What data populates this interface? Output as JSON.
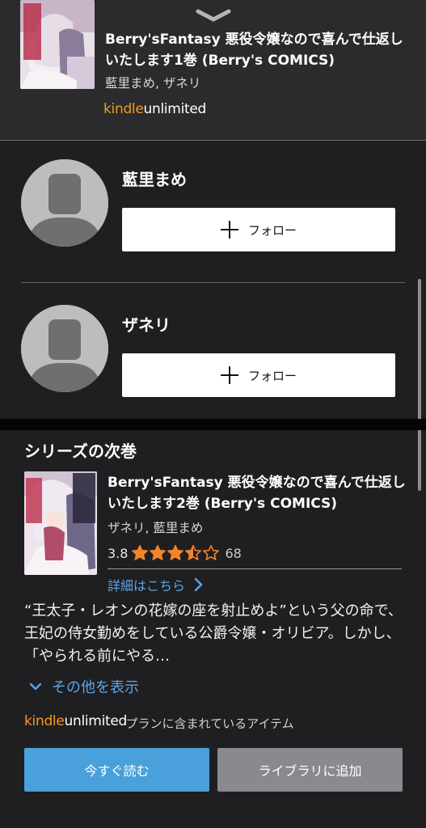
{
  "current_book": {
    "title": "Berry'sFantasy 悪役令嬢なので喜んで仕返しいたします1巻 (Berry's COMICS)",
    "authors": "藍里まめ, ザネリ",
    "kindle_unlimited": {
      "kindle": "kindle",
      "unlimited": "unlimited"
    }
  },
  "authors": [
    {
      "name": "藍里まめ",
      "follow_label": "フォロー"
    },
    {
      "name": "ザネリ",
      "follow_label": "フォロー"
    }
  ],
  "series_next": {
    "section_title": "シリーズの次巻",
    "title": "Berry'sFantasy 悪役令嬢なので喜んで仕返しいたします2巻 (Berry's COMICS)",
    "authors": "ザネリ, 藍里まめ",
    "rating": "3.8",
    "rating_value": 3.8,
    "rating_count": "68",
    "details_link": "詳細はこちら",
    "description": "“王太子・レオンの花嫁の座を射止めよ”という父の命で、王妃の侍女勤めをしている公爵令嬢・オリビア。しかし、「やられる前にやる…",
    "show_more": "その他を表示",
    "kindle_unlimited": {
      "kindle": "kindle",
      "unlimited": "unlimited"
    },
    "plan_text": "· プランに含まれているアイテム"
  },
  "actions": {
    "read_now": "今すぐ読む",
    "add_to_library": "ライブラリに追加"
  },
  "colors": {
    "background": "#1f1f21",
    "header_background": "#2b2b2e",
    "kindle_orange": "#f39a23",
    "link_blue": "#5ca4e8",
    "star_orange": "#f3842b",
    "read_button": "#4aa0da",
    "library_button": "#8a898e"
  }
}
